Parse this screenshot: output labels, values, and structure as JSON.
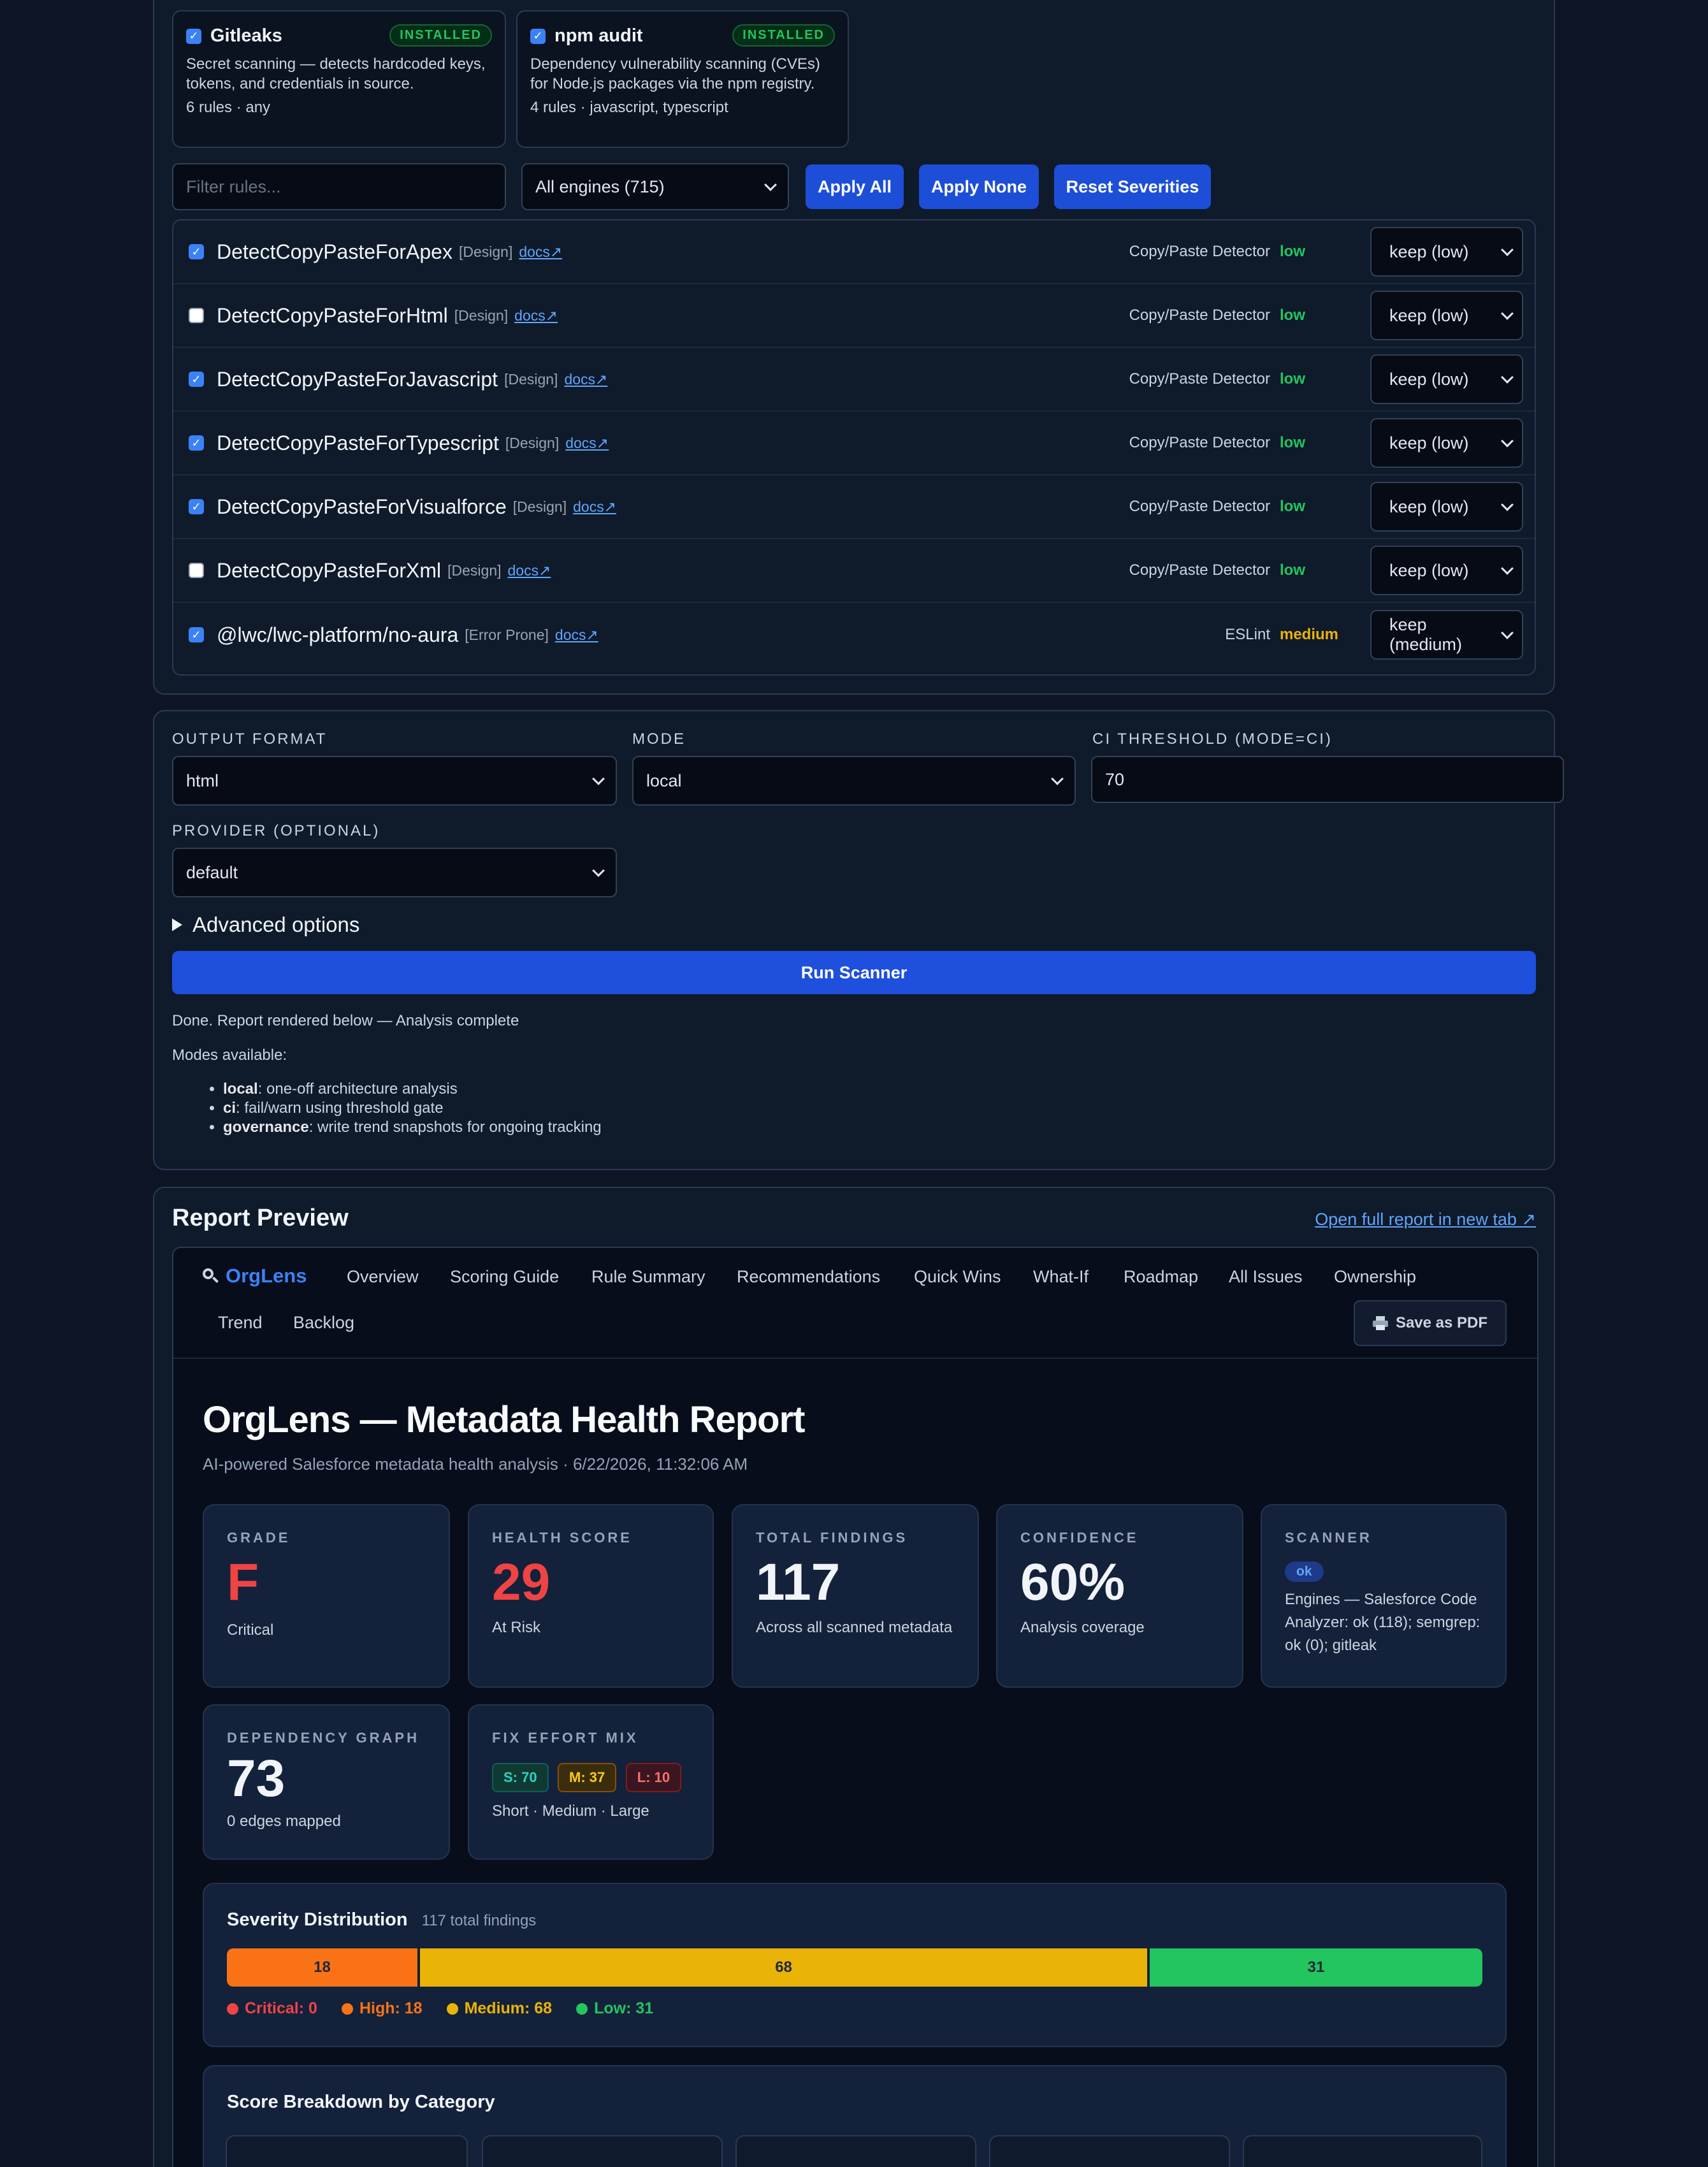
{
  "engines": [
    {
      "name": "Gitleaks",
      "badge": "INSTALLED",
      "description": "Secret scanning — detects hardcoded keys, tokens, and credentials in source.",
      "meta": "6 rules · any"
    },
    {
      "name": "npm audit",
      "badge": "INSTALLED",
      "description": "Dependency vulnerability scanning (CVEs) for Node.js packages via the npm registry.",
      "meta": "4 rules · javascript, typescript"
    }
  ],
  "filters": {
    "filter_placeholder": "Filter rules...",
    "engine_select": "All engines (715)",
    "apply_all": "Apply All",
    "apply_none": "Apply None",
    "reset_severities": "Reset Severities"
  },
  "rules": [
    {
      "name": "DetectCopyPasteForApex",
      "category": "[Design]",
      "docs": "docs↗",
      "engine": "Copy/Paste Detector",
      "severity": "low",
      "action": "keep (low)",
      "checked": true
    },
    {
      "name": "DetectCopyPasteForHtml",
      "category": "[Design]",
      "docs": "docs↗",
      "engine": "Copy/Paste Detector",
      "severity": "low",
      "action": "keep (low)",
      "checked": false
    },
    {
      "name": "DetectCopyPasteForJavascript",
      "category": "[Design]",
      "docs": "docs↗",
      "engine": "Copy/Paste Detector",
      "severity": "low",
      "action": "keep (low)",
      "checked": true
    },
    {
      "name": "DetectCopyPasteForTypescript",
      "category": "[Design]",
      "docs": "docs↗",
      "engine": "Copy/Paste Detector",
      "severity": "low",
      "action": "keep (low)",
      "checked": true
    },
    {
      "name": "DetectCopyPasteForVisualforce",
      "category": "[Design]",
      "docs": "docs↗",
      "engine": "Copy/Paste Detector",
      "severity": "low",
      "action": "keep (low)",
      "checked": true
    },
    {
      "name": "DetectCopyPasteForXml",
      "category": "[Design]",
      "docs": "docs↗",
      "engine": "Copy/Paste Detector",
      "severity": "low",
      "action": "keep (low)",
      "checked": false
    },
    {
      "name": "@lwc/lwc-platform/no-aura",
      "category": "[Error Prone]",
      "docs": "docs↗",
      "engine": "ESLint",
      "severity": "medium",
      "action": "keep (medium)",
      "checked": true
    }
  ],
  "form": {
    "output_format_label": "OUTPUT FORMAT",
    "output_format_value": "html",
    "mode_label": "MODE",
    "mode_value": "local",
    "ci_label": "CI THRESHOLD (MODE=CI)",
    "ci_value": "70",
    "provider_label": "PROVIDER (OPTIONAL)",
    "provider_value": "default",
    "advanced": "Advanced options",
    "run_button": "Run Scanner",
    "status": "Done. Report rendered below — Analysis complete",
    "modes_title": "Modes available:",
    "modes": [
      {
        "key": "local",
        "desc": ": one-off architecture analysis"
      },
      {
        "key": "ci",
        "desc": ": fail/warn using threshold gate"
      },
      {
        "key": "governance",
        "desc": ": write trend snapshots for ongoing tracking"
      }
    ]
  },
  "report": {
    "section_title": "Report Preview",
    "open_link": "Open full report in new tab ↗",
    "brand": "OrgLens",
    "nav": [
      "Overview",
      "Scoring Guide",
      "Rule Summary",
      "Recommendations",
      "Quick Wins",
      "What-If",
      "Roadmap",
      "All Issues",
      "Ownership",
      "Trend",
      "Backlog"
    ],
    "save_pdf": "Save as PDF",
    "title": "OrgLens — Metadata Health Report",
    "subtitle": "AI-powered Salesforce metadata health analysis · 6/22/2026, 11:32:06 AM",
    "stats": {
      "grade": {
        "label": "GRADE",
        "value": "F",
        "sub": "Critical"
      },
      "health": {
        "label": "HEALTH SCORE",
        "value": "29",
        "sub": "At Risk"
      },
      "findings": {
        "label": "TOTAL FINDINGS",
        "value": "117",
        "sub": "Across all scanned metadata"
      },
      "confidence": {
        "label": "CONFIDENCE",
        "value": "60%",
        "sub": "Analysis coverage"
      },
      "scanner": {
        "label": "SCANNER",
        "badge": "ok",
        "sub": "Engines — Salesforce Code Analyzer: ok (118); semgrep: ok (0); gitleak"
      },
      "dependency": {
        "label": "DEPENDENCY GRAPH",
        "value": "73",
        "sub": "0 edges mapped"
      },
      "effort": {
        "label": "FIX EFFORT MIX",
        "chips": [
          "S: 70",
          "M: 37",
          "L: 10"
        ],
        "sub": "Short · Medium · Large"
      }
    },
    "severity": {
      "title": "Severity Distribution",
      "total": "117 total findings",
      "segments": [
        {
          "label": "18",
          "value": 18,
          "color": "#f97316"
        },
        {
          "label": "68",
          "value": 68,
          "color": "#eab308"
        },
        {
          "label": "31",
          "value": 31,
          "color": "#22c55e"
        }
      ],
      "legend": [
        {
          "text": "Critical: 0",
          "color": "#ef4444"
        },
        {
          "text": "High: 18",
          "color": "#f97316"
        },
        {
          "text": "Medium: 68",
          "color": "#eab308"
        },
        {
          "text": "Low: 31",
          "color": "#22c55e"
        }
      ]
    },
    "breakdown_title": "Score Breakdown by Category"
  }
}
